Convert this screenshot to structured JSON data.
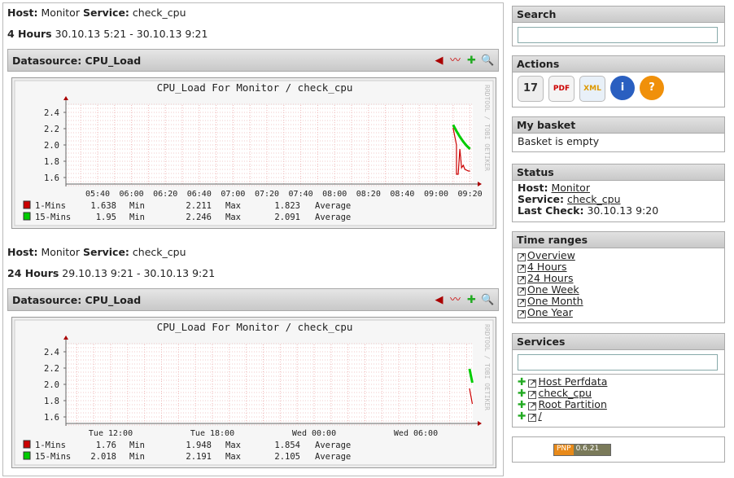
{
  "graphs": [
    {
      "host_label": "Host:",
      "host": "Monitor",
      "service_label": "Service:",
      "service": "check_cpu",
      "range_label": "4 Hours",
      "range": "30.10.13 5:21 - 30.10.13 9:21",
      "datasource": "Datasource: CPU_Load",
      "legend": [
        {
          "name": "1-Mins",
          "min": "1.638",
          "max": "2.211",
          "avg": "1.823",
          "min_l": "Min",
          "max_l": "Max",
          "avg_l": "Average"
        },
        {
          "name": "15-Mins",
          "min": "1.95",
          "max": "2.246",
          "avg": "2.091",
          "min_l": "Min",
          "max_l": "Max",
          "avg_l": "Average"
        }
      ]
    },
    {
      "host_label": "Host:",
      "host": "Monitor",
      "service_label": "Service:",
      "service": "check_cpu",
      "range_label": "24 Hours",
      "range": "29.10.13 9:21 - 30.10.13 9:21",
      "datasource": "Datasource: CPU_Load",
      "legend": [
        {
          "name": "1-Mins",
          "min": "1.76",
          "max": "1.948",
          "avg": "1.854",
          "min_l": "Min",
          "max_l": "Max",
          "avg_l": "Average"
        },
        {
          "name": "15-Mins",
          "min": "2.018",
          "max": "2.191",
          "avg": "2.105",
          "min_l": "Min",
          "max_l": "Max",
          "avg_l": "Average"
        }
      ]
    }
  ],
  "chart_data": [
    {
      "type": "line",
      "title": "CPU_Load For Monitor / check_cpu",
      "watermark": "RRDTOOL / TOBI OETIKER",
      "ylim": [
        1.5,
        2.55
      ],
      "yticks": [
        "1.6",
        "1.8",
        "2.0",
        "2.2",
        "2.4"
      ],
      "xticks": [
        "05:40",
        "06:00",
        "06:20",
        "06:40",
        "07:00",
        "07:20",
        "07:40",
        "08:00",
        "08:20",
        "08:40",
        "09:00",
        "09:20"
      ],
      "grid": true,
      "series": [
        {
          "name": "1-Mins",
          "color": "#cc0000",
          "x": [
            "09:10",
            "09:12",
            "09:12",
            "09:13",
            "09:14",
            "09:15",
            "09:15",
            "09:16",
            "09:17",
            "09:18",
            "09:19",
            "09:20"
          ],
          "y": [
            2.21,
            2.0,
            1.64,
            1.64,
            1.95,
            1.72,
            1.72,
            1.75,
            1.7,
            1.69,
            1.68,
            1.68
          ]
        },
        {
          "name": "15-Mins",
          "color": "#00cc00",
          "x": [
            "09:10",
            "09:12",
            "09:14",
            "09:16",
            "09:18",
            "09:20"
          ],
          "y": [
            2.246,
            2.17,
            2.1,
            2.04,
            1.99,
            1.95
          ]
        }
      ]
    },
    {
      "type": "line",
      "title": "CPU_Load For Monitor / check_cpu",
      "watermark": "RRDTOOL / TOBI OETIKER",
      "ylim": [
        1.5,
        2.55
      ],
      "yticks": [
        "1.6",
        "1.8",
        "2.0",
        "2.2",
        "2.4"
      ],
      "xticks": [
        "Tue 12:00",
        "Tue 18:00",
        "Wed 00:00",
        "Wed 06:00"
      ],
      "grid": true,
      "series": [
        {
          "name": "1-Mins",
          "color": "#cc0000",
          "x": [
            "Wed 09:10",
            "Wed 09:20"
          ],
          "y": [
            1.95,
            1.76
          ]
        },
        {
          "name": "15-Mins",
          "color": "#00cc00",
          "x": [
            "Wed 09:10",
            "Wed 09:20"
          ],
          "y": [
            2.19,
            2.02
          ]
        }
      ]
    }
  ],
  "sidebar": {
    "search": {
      "title": "Search",
      "value": ""
    },
    "actions": {
      "title": "Actions",
      "icons": [
        "calendar-icon",
        "pdf-icon",
        "xml-icon",
        "info-icon",
        "help-icon"
      ]
    },
    "basket": {
      "title": "My basket",
      "text": "Basket is empty"
    },
    "status": {
      "title": "Status",
      "host_label": "Host:",
      "host": "Monitor",
      "service_label": "Service:",
      "service": "check_cpu",
      "last_label": "Last Check:",
      "last": "30.10.13 9:20"
    },
    "time_ranges": {
      "title": "Time ranges",
      "items": [
        "Overview",
        "4 Hours",
        "24 Hours",
        "One Week",
        "One Month",
        "One Year"
      ]
    },
    "services": {
      "title": "Services",
      "value": "",
      "items": [
        "Host Perfdata",
        "check_cpu",
        "Root Partition",
        "/"
      ]
    },
    "footer": {
      "badge_left": "PNP",
      "badge_right": "0.6.21"
    }
  }
}
